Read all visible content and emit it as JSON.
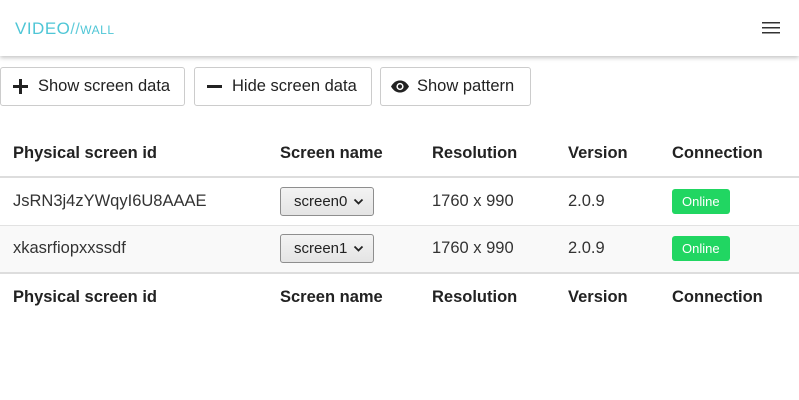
{
  "brand": {
    "video": "VIDEO",
    "slash": "//",
    "wall": "WALL",
    "color": "#4fc6d6"
  },
  "header": {
    "menu_icon": "hamburger-menu-icon"
  },
  "toolbar": {
    "show_label": "Show screen data",
    "show_icon": "plus-icon",
    "hide_label": "Hide screen data",
    "hide_icon": "minus-icon",
    "pattern_label": "Show pattern",
    "pattern_icon": "eye-icon"
  },
  "table": {
    "columns": [
      "Physical screen id",
      "Screen name",
      "Resolution",
      "Version",
      "Connection"
    ],
    "rows": [
      {
        "id": "JsRN3j4zYWqyI6U8AAAE",
        "name": "screen0",
        "resolution": "1760 x 990",
        "version": "2.0.9",
        "connection": "Online"
      },
      {
        "id": "xkasrfiopxxssdf",
        "name": "screen1",
        "resolution": "1760 x 990",
        "version": "2.0.9",
        "connection": "Online"
      }
    ],
    "online_color": "#21d662"
  }
}
